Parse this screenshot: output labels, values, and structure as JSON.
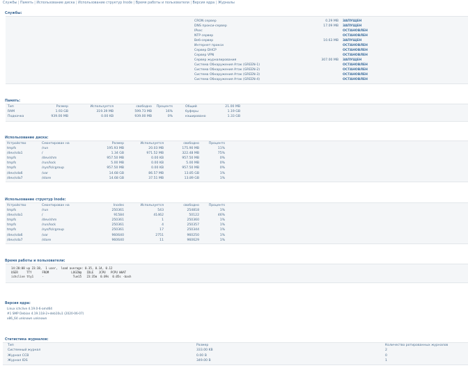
{
  "nav": [
    "Службы",
    "Память",
    "Использование диска",
    "Использование структур Inode",
    "Время работы и пользователи",
    "Версия ядра",
    "Журналы"
  ],
  "services": {
    "title": "Службы:",
    "rows": [
      {
        "name": "CRON сервер",
        "mem": "0.29 MB",
        "status": "ЗАПУЩЕН",
        "running": true
      },
      {
        "name": "DNS прокси-сервер",
        "mem": "17.09 MB",
        "status": "ЗАПУЩЕН",
        "running": true
      },
      {
        "name": "IPsec",
        "mem": "",
        "status": "ОСТАНОВЛЕН",
        "running": false
      },
      {
        "name": "NTP сервер",
        "mem": "",
        "status": "ОСТАНОВЛЕН",
        "running": false
      },
      {
        "name": "Веб-сервер",
        "mem": "10.63 MB",
        "status": "ЗАПУЩЕН",
        "running": true
      },
      {
        "name": "Интернет прокси",
        "mem": "",
        "status": "ОСТАНОВЛЕН",
        "running": false
      },
      {
        "name": "Сервер DHCP",
        "mem": "",
        "status": "ОСТАНОВЛЕН",
        "running": false
      },
      {
        "name": "Сервер VPN",
        "mem": "",
        "status": "ОСТАНОВЛЕН",
        "running": false
      },
      {
        "name": "Сервер журналирования",
        "mem": "307.00 MB",
        "status": "ЗАПУЩЕН",
        "running": true
      },
      {
        "name": "Система Обнаружения Атак (GREEN-1)",
        "mem": "",
        "status": "ОСТАНОВЛЕН",
        "running": false
      },
      {
        "name": "Система Обнаружения Атак (GREEN-2)",
        "mem": "",
        "status": "ОСТАНОВЛЕН",
        "running": false
      },
      {
        "name": "Система Обнаружения Атак (GREEN-3)",
        "mem": "",
        "status": "ОСТАНОВЛЕН",
        "running": false
      },
      {
        "name": "Система Обнаружения Атак (GREEN-4)",
        "mem": "",
        "status": "ОСТАНОВЛЕН",
        "running": false
      }
    ]
  },
  "memory": {
    "title": "Память:",
    "headers": [
      "Тип",
      "Размер",
      "Используется",
      "свободно",
      "Процентs",
      "Общий",
      "21.00 MB"
    ],
    "rows": [
      [
        "RAM",
        "1.93 GB",
        "319.39 MB",
        "599.73 MB",
        "16%",
        "буферы",
        "1.19 GB"
      ],
      [
        "Подкачка",
        "939.00 MB",
        "0.00 KB",
        "939.00 MB",
        "0%",
        "кэшировано",
        "1.33 GB"
      ]
    ]
  },
  "disk": {
    "title": "Использование диска:",
    "headers": [
      "Устройство",
      "Смонтирован на",
      "Размер",
      "Используется",
      "свободно",
      "Процентs"
    ],
    "rows": [
      [
        "tmpfs",
        "/run",
        "195.93 MB",
        "20.03 MB",
        "175.90 MB",
        "11%"
      ],
      [
        "/dev/sda1",
        "/",
        "1.34 GB",
        "971.52 MB",
        "322.48 MB",
        "75%"
      ],
      [
        "tmpfs",
        "/dev/shm",
        "957.50 MB",
        "0.00 KB",
        "957.50 MB",
        "0%"
      ],
      [
        "tmpfs",
        "/run/lock",
        "5.00 MB",
        "0.00 KB",
        "5.00 MB",
        "0%"
      ],
      [
        "tmpfs",
        "/sys/fs/cgroup",
        "957.50 MB",
        "0.00 KB",
        "957.50 MB",
        "0%"
      ],
      [
        "/dev/sda6",
        "/var",
        "14.68 GB",
        "86.57 MB",
        "13.85 GB",
        "1%"
      ],
      [
        "/dev/sda7",
        "/store",
        "14.68 GB",
        "37.51 MB",
        "13.89 GB",
        "1%"
      ]
    ]
  },
  "inode": {
    "title": "Использование структур Inode:",
    "headers": [
      "Устройство",
      "Смонтирован на",
      "Inodes",
      "Используется",
      "свободно",
      "Процентs"
    ],
    "rows": [
      [
        "tmpfs",
        "/run",
        "250361",
        "543",
        "254818",
        "1%"
      ],
      [
        "/dev/sda1",
        "/",
        "91584",
        "41462",
        "50122",
        "46%"
      ],
      [
        "tmpfs",
        "/dev/shm",
        "250361",
        "1",
        "250360",
        "1%"
      ],
      [
        "tmpfs",
        "/run/lock",
        "250361",
        "4",
        "250357",
        "1%"
      ],
      [
        "tmpfs",
        "/sys/fs/cgroup",
        "250361",
        "17",
        "250344",
        "1%"
      ],
      [
        "/dev/sda6",
        "/var",
        "960640",
        "2751",
        "960250",
        "1%"
      ],
      [
        "/dev/sda7",
        "/store",
        "960640",
        "11",
        "960629",
        "1%"
      ]
    ]
  },
  "uptime": {
    "title": "Время работы и пользователи:",
    "line1": "14:20:08 up 23:38,  1 user,  load average: 0.35, 0.14, 0.12",
    "line2": "USER     TTY      FROM             LOGIN@   IDLE   JCPU   PCPU WHAT",
    "line3": "ichclive tty1     -                 Tue15   23:35m  0.09s  0.05s -bash"
  },
  "kernel": {
    "title": "Версия ядра:",
    "line1": "Linux ichclive 4.19.0-6-amd64",
    "line2": "#1 SMP Debian 4.19.118-2+deb10u1 (2020-06-07)",
    "line3": "x86_64 unknown unknown"
  },
  "logs": {
    "title": "Статистика журналов:",
    "headers": [
      "Тип",
      "Размер",
      "Количество ротированных журналов"
    ],
    "rows": [
      [
        "Системный журнал",
        "333.00 KB",
        "2"
      ],
      [
        "Журнал CCB",
        "0.00 B",
        "0"
      ],
      [
        "Журнал IDS",
        "349.00 B",
        "1"
      ]
    ]
  }
}
